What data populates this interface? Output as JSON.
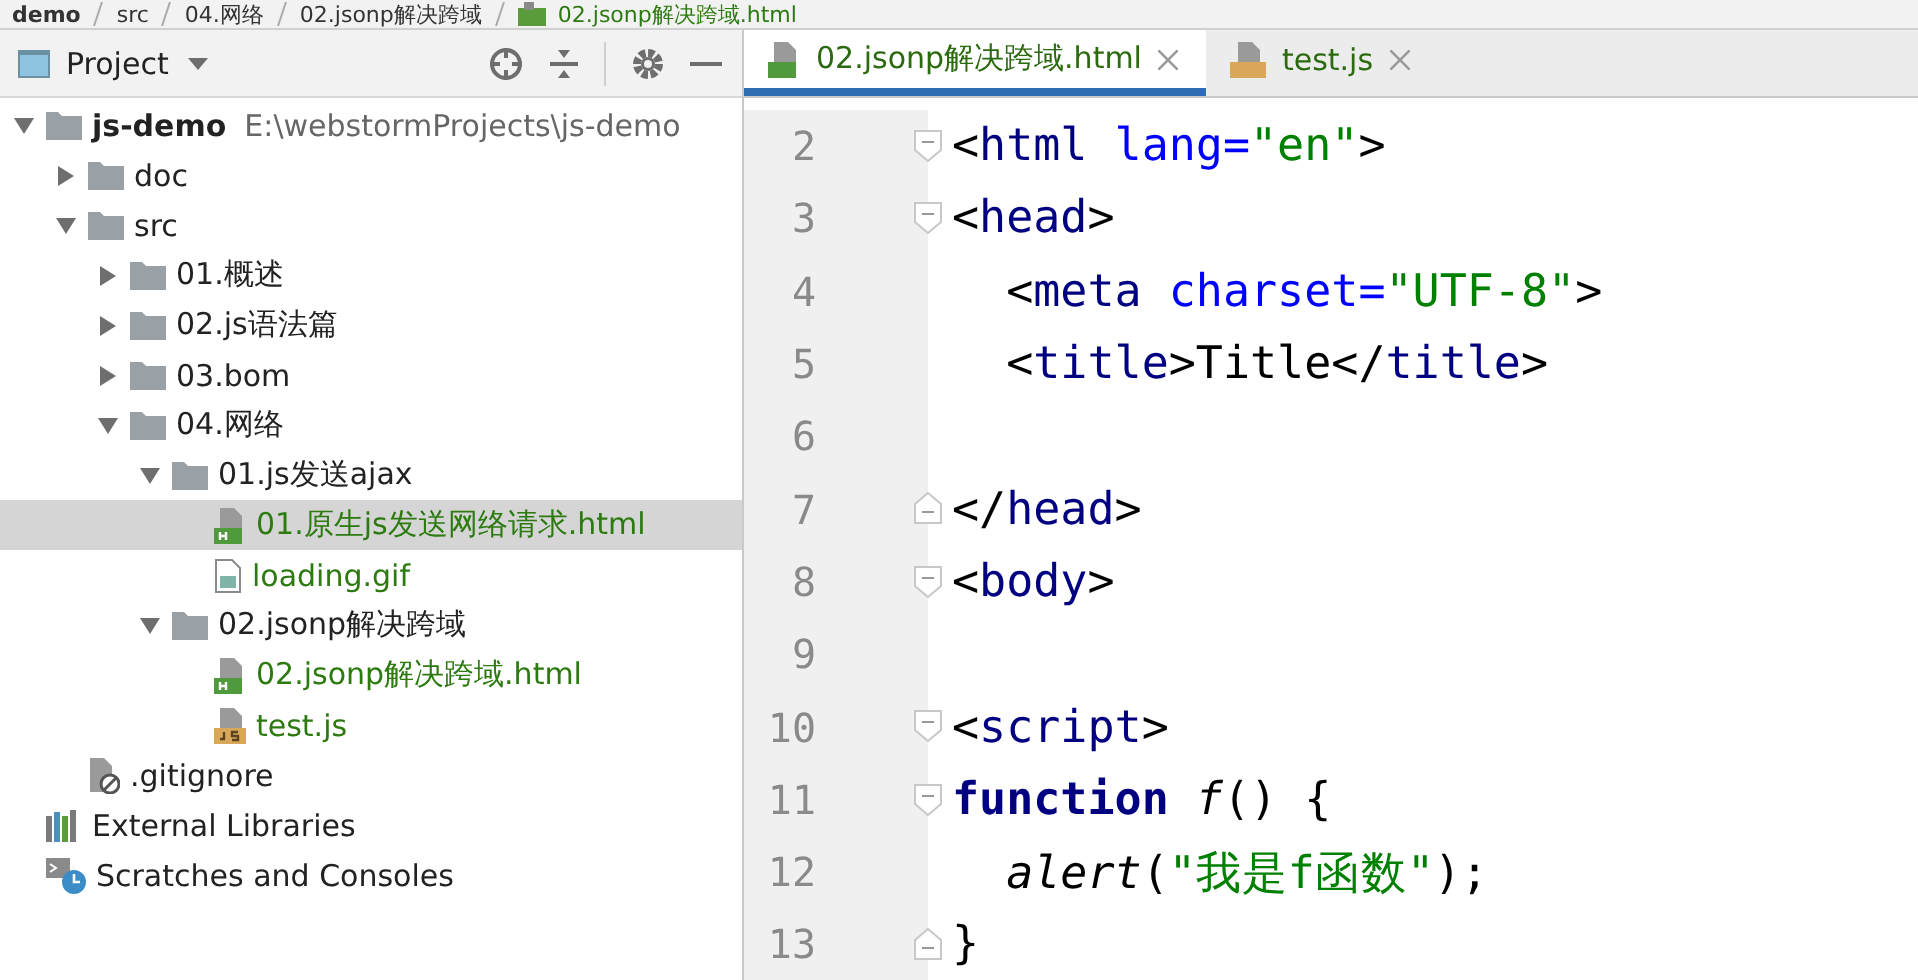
{
  "breadcrumb": [
    {
      "label": "demo",
      "kind": "project"
    },
    {
      "label": "src",
      "kind": "folder"
    },
    {
      "label": "04.网络",
      "kind": "folder"
    },
    {
      "label": "02.jsonp解决跨域",
      "kind": "folder"
    },
    {
      "label": "02.jsonp解决跨域.html",
      "kind": "html"
    }
  ],
  "panel": {
    "title": "Project"
  },
  "tree": [
    {
      "name": "js-demo",
      "path": "E:\\webstormProjects\\js-demo",
      "kind": "folder",
      "expanded": true,
      "selected": false,
      "added": false,
      "children": [
        {
          "name": "doc",
          "kind": "folder",
          "expanded": false,
          "selected": false,
          "added": false
        },
        {
          "name": "src",
          "kind": "folder",
          "expanded": true,
          "selected": false,
          "added": false,
          "children": [
            {
              "name": "01.概述",
              "kind": "folder",
              "expanded": false,
              "selected": false,
              "added": false
            },
            {
              "name": "02.js语法篇",
              "kind": "folder",
              "expanded": false,
              "selected": false,
              "added": false
            },
            {
              "name": "03.bom",
              "kind": "folder",
              "expanded": false,
              "selected": false,
              "added": false
            },
            {
              "name": "04.网络",
              "kind": "folder",
              "expanded": true,
              "selected": false,
              "added": false,
              "children": [
                {
                  "name": "01.js发送ajax",
                  "kind": "folder",
                  "expanded": true,
                  "selected": false,
                  "added": false,
                  "children": [
                    {
                      "name": "01.原生js发送网络请求.html",
                      "kind": "html",
                      "added": true,
                      "selected": true
                    },
                    {
                      "name": "loading.gif",
                      "kind": "image",
                      "added": true,
                      "selected": false
                    }
                  ]
                },
                {
                  "name": "02.jsonp解决跨域",
                  "kind": "folder",
                  "expanded": true,
                  "selected": false,
                  "added": false,
                  "children": [
                    {
                      "name": "02.jsonp解决跨域.html",
                      "kind": "html",
                      "added": true,
                      "selected": false
                    },
                    {
                      "name": "test.js",
                      "kind": "js",
                      "added": true,
                      "selected": false
                    }
                  ]
                }
              ]
            }
          ]
        },
        {
          "name": ".gitignore",
          "kind": "ignored",
          "selected": false,
          "added": false
        }
      ]
    },
    {
      "name": "External Libraries",
      "kind": "libraries",
      "selected": false,
      "added": false
    },
    {
      "name": "Scratches and Consoles",
      "kind": "scratches",
      "selected": false,
      "added": false
    }
  ],
  "tabs": [
    {
      "label": "02.jsonp解决跨域.html",
      "kind": "html",
      "selected": true
    },
    {
      "label": "test.js",
      "kind": "js",
      "selected": false
    }
  ],
  "code": [
    {
      "number": "2",
      "kind": "opener",
      "tokens": [
        {
          "t": "<",
          "kind": "plain"
        },
        {
          "t": "html",
          "kind": "tag"
        },
        {
          "t": " lang=",
          "kind": "attr"
        },
        {
          "t": "\"en\"",
          "kind": "str"
        },
        {
          "t": ">",
          "kind": "plain"
        }
      ]
    },
    {
      "number": "3",
      "kind": "opener",
      "tokens": [
        {
          "t": "<",
          "kind": "plain"
        },
        {
          "t": "head",
          "kind": "tag"
        },
        {
          "t": ">",
          "kind": "plain"
        }
      ]
    },
    {
      "number": "4",
      "kind": "plain",
      "tokens": [
        {
          "t": "  <",
          "kind": "plain"
        },
        {
          "t": "meta",
          "kind": "tag"
        },
        {
          "t": " charset=",
          "kind": "attr"
        },
        {
          "t": "\"UTF-8\"",
          "kind": "str"
        },
        {
          "t": ">",
          "kind": "plain"
        }
      ]
    },
    {
      "number": "5",
      "kind": "plain",
      "tokens": [
        {
          "t": "  <",
          "kind": "plain"
        },
        {
          "t": "title",
          "kind": "tag"
        },
        {
          "t": ">Title</",
          "kind": "plain"
        },
        {
          "t": "title",
          "kind": "tag"
        },
        {
          "t": ">",
          "kind": "plain"
        }
      ]
    },
    {
      "number": "6",
      "kind": "plain"
    },
    {
      "number": "7",
      "kind": "closer",
      "tokens": [
        {
          "t": "</",
          "kind": "plain"
        },
        {
          "t": "head",
          "kind": "tag"
        },
        {
          "t": ">",
          "kind": "plain"
        }
      ]
    },
    {
      "number": "8",
      "kind": "opener",
      "tokens": [
        {
          "t": "<",
          "kind": "plain"
        },
        {
          "t": "body",
          "kind": "tag"
        },
        {
          "t": ">",
          "kind": "plain"
        }
      ]
    },
    {
      "number": "9",
      "kind": "plain"
    },
    {
      "number": "10",
      "kind": "opener",
      "tokens": [
        {
          "t": "<",
          "kind": "plain"
        },
        {
          "t": "script",
          "kind": "tag"
        },
        {
          "t": ">",
          "kind": "plain"
        }
      ]
    },
    {
      "number": "11",
      "kind": "opener",
      "tokens": [
        {
          "t": "function ",
          "kind": "keyword"
        },
        {
          "t": "f",
          "kind": "call"
        },
        {
          "t": "() {",
          "kind": "plain"
        }
      ]
    },
    {
      "number": "12",
      "kind": "plain",
      "tokens": [
        {
          "t": "  alert",
          "kind": "call"
        },
        {
          "t": "(",
          "kind": "plain"
        },
        {
          "t": "\"我是f函数\"",
          "kind": "str"
        },
        {
          "t": ");",
          "kind": "plain"
        }
      ]
    },
    {
      "number": "13",
      "kind": "closer",
      "tokens": [
        {
          "t": "}",
          "kind": "plain"
        }
      ]
    }
  ]
}
